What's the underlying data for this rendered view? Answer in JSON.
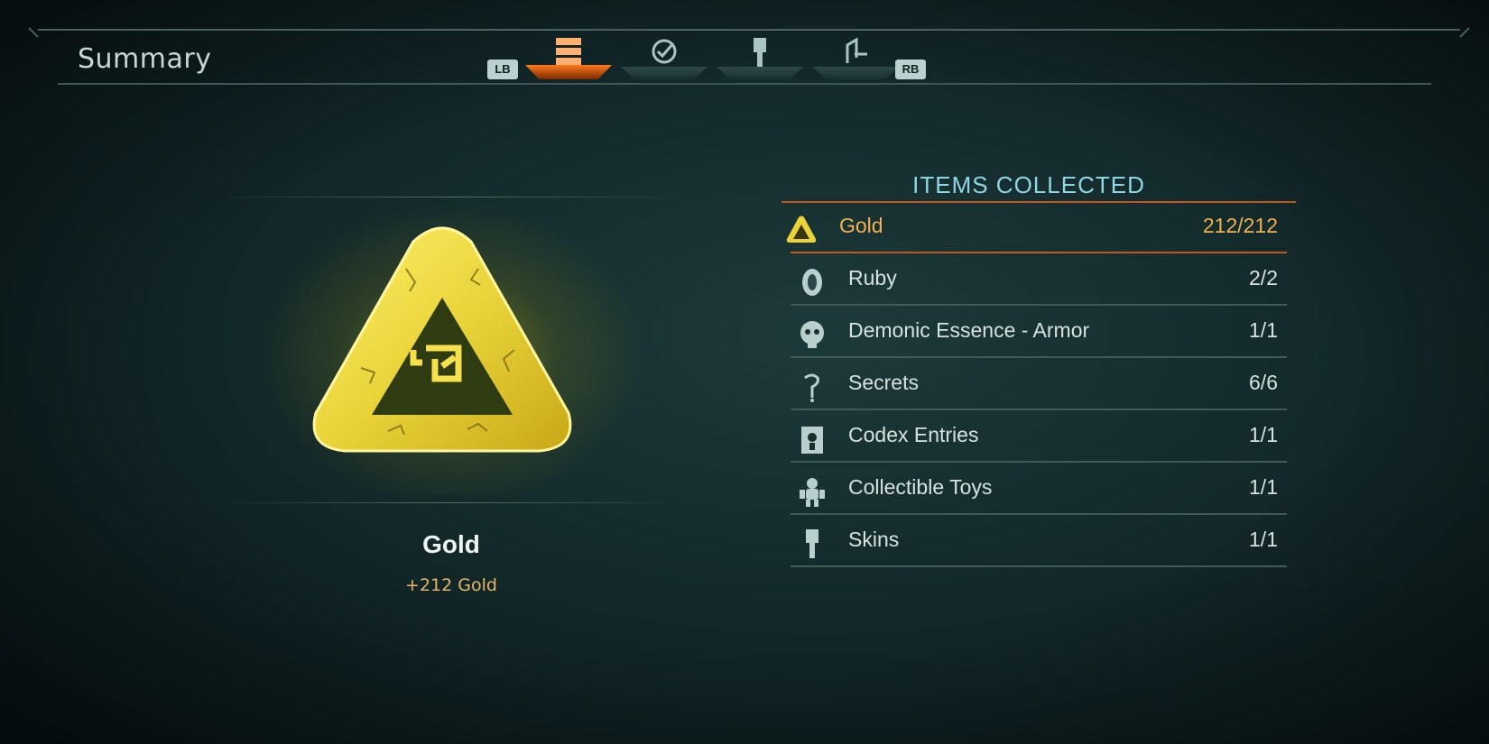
{
  "header": {
    "title": "Summary",
    "left_bumper": "LB",
    "right_bumper": "RB",
    "tabs": [
      {
        "icon": "collectibles-icon",
        "active": true
      },
      {
        "icon": "checkmark-icon",
        "active": false
      },
      {
        "icon": "paintbrush-icon",
        "active": false
      },
      {
        "icon": "exit-icon",
        "active": false
      }
    ]
  },
  "selected": {
    "name": "Gold",
    "description": "+212 Gold",
    "icon": "gold-emblem-icon"
  },
  "items": {
    "title": "ITEMS COLLECTED",
    "rows": [
      {
        "label": "Gold",
        "count": "212/212",
        "icon": "gold-icon",
        "selected": true
      },
      {
        "label": "Ruby",
        "count": "2/2",
        "icon": "ruby-icon"
      },
      {
        "label": "Demonic Essence - Armor",
        "count": "1/1",
        "icon": "demonic-essence-icon"
      },
      {
        "label": "Secrets",
        "count": "6/6",
        "icon": "secrets-icon"
      },
      {
        "label": "Codex Entries",
        "count": "1/1",
        "icon": "codex-icon"
      },
      {
        "label": "Collectible Toys",
        "count": "1/1",
        "icon": "toy-icon"
      },
      {
        "label": "Skins",
        "count": "1/1",
        "icon": "skin-brush-icon"
      }
    ]
  },
  "colors": {
    "accent_orange": "#f0b252",
    "title_cyan": "#8fd6e3",
    "gold": "#e9d43a"
  }
}
